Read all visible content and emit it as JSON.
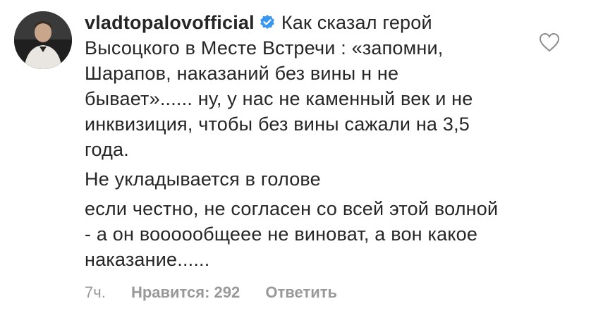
{
  "comment": {
    "username": "vladtopalovofficial",
    "verified": true,
    "paragraphs": [
      "Как сказал герой Высоцкого в Месте Встречи : «запомни, Шарапов, наказаний без вины н не бывает»...... ну, у нас не каменный век и не инквизиция, чтобы без вины сажали на 3,5 года.",
      "Не укладывается в голове",
      "если честно, не согласен со всей этой волной - а он вооооoбщееe не виноват, а вон какое наказание......"
    ],
    "time": "7ч.",
    "likes": "Нравится: 292",
    "reply": "Ответить"
  },
  "icons": {
    "verified": "verified-badge-icon",
    "heart": "heart-outline-icon",
    "avatar": "profile-photo"
  },
  "colors": {
    "text": "#262626",
    "meta": "#999999",
    "verified": "#3897f0"
  }
}
